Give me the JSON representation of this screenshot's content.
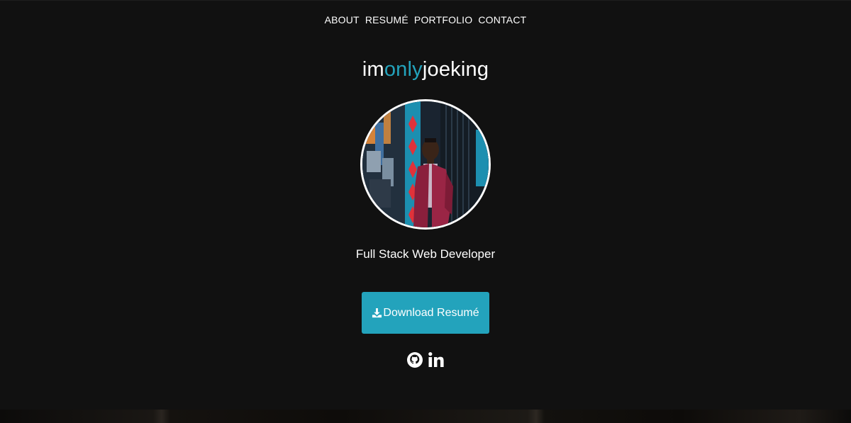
{
  "nav": {
    "items": [
      {
        "label": "ABOUT"
      },
      {
        "label": "RESUMÉ"
      },
      {
        "label": "PORTFOLIO"
      },
      {
        "label": "CONTACT"
      }
    ]
  },
  "brand": {
    "part1": "im",
    "part2": "only",
    "part3": "joeking"
  },
  "hero": {
    "role": "Full Stack Web Developer",
    "download_label": "Download Resumé"
  },
  "social": {
    "icons": [
      "github-icon",
      "linkedin-icon"
    ]
  },
  "colors": {
    "background": "#111111",
    "accent": "#23a3bc",
    "text": "#ffffff"
  }
}
